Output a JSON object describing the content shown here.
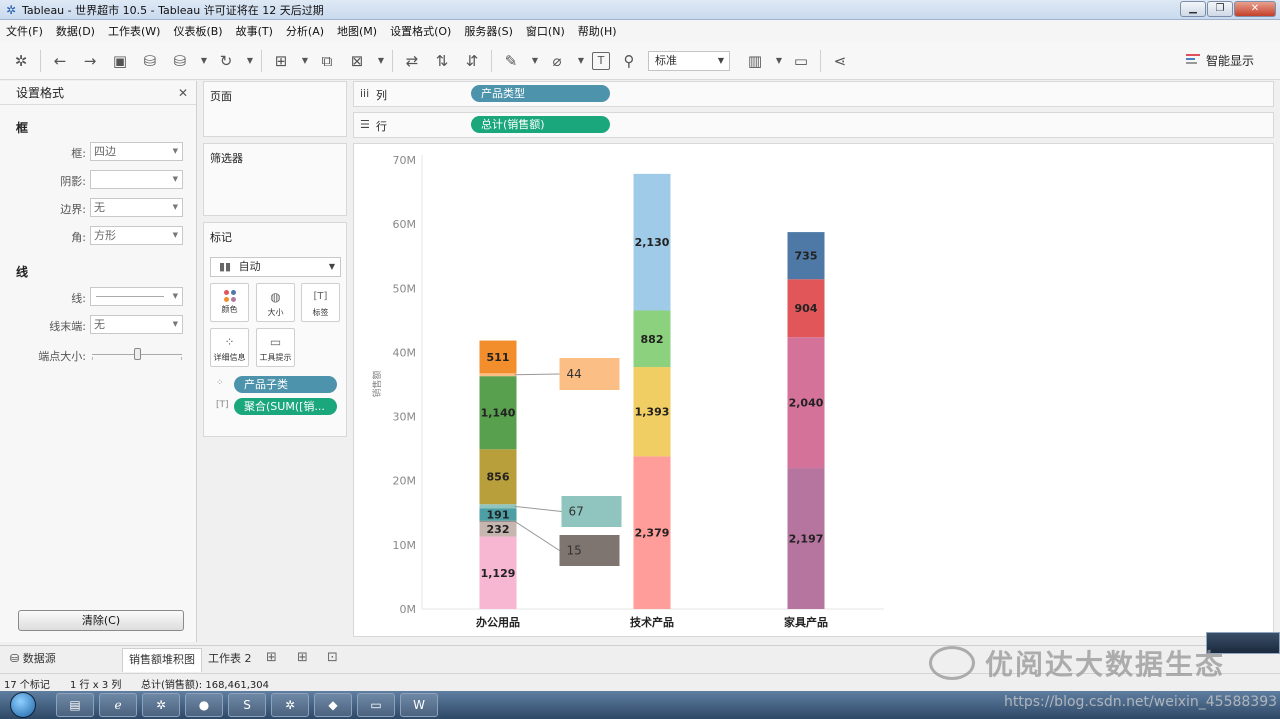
{
  "window": {
    "title": "Tableau - 世界超市 10.5 - Tableau 许可证将在 12 天后过期"
  },
  "menu": [
    "文件(F)",
    "数据(D)",
    "工作表(W)",
    "仪表板(B)",
    "故事(T)",
    "分析(A)",
    "地图(M)",
    "设置格式(O)",
    "服务器(S)",
    "窗口(N)",
    "帮助(H)"
  ],
  "toolbar": {
    "fit_value": "标准",
    "show_me": "智能显示"
  },
  "format_pane": {
    "title": "设置格式",
    "section_box": "框",
    "box_rows": [
      {
        "label": "框:",
        "value": "四边"
      },
      {
        "label": "阴影:",
        "value": ""
      },
      {
        "label": "边界:",
        "value": "无"
      },
      {
        "label": "角:",
        "value": "方形"
      }
    ],
    "section_line": "线",
    "line_rows": [
      {
        "label": "线:",
        "value": ""
      },
      {
        "label": "线末端:",
        "value": "无"
      }
    ],
    "endpoint_size_label": "端点大小:",
    "endpoint_size_level": 0.5,
    "clear_button": "清除(C)"
  },
  "shelves": {
    "pages": "页面",
    "filters": "筛选器",
    "marks": "标记",
    "marks_type": "自动",
    "mark_buttons": [
      "颜色",
      "大小",
      "标签",
      "详细信息",
      "工具提示"
    ],
    "mark_pills": [
      "产品子类",
      "聚合(SUM([销..."
    ],
    "columns_label": "列",
    "rows_label": "行",
    "columns_pill": "产品类型",
    "rows_pill": "总计(销售额)"
  },
  "chart_data": {
    "type": "bar",
    "stacked": true,
    "ylabel": "销售额",
    "ylim": [
      0,
      70000000
    ],
    "yticks": [
      "0M",
      "10M",
      "20M",
      "30M",
      "40M",
      "50M",
      "60M",
      "70M"
    ],
    "categories": [
      "办公用品",
      "技术产品",
      "家具产品"
    ],
    "bars": [
      {
        "category": "办公用品",
        "segments": [
          {
            "label": "1,129",
            "value": 11290000,
            "color": "#f7b6d2"
          },
          {
            "label": "232",
            "value": 2320000,
            "color": "#c7b6b0"
          },
          {
            "label": "15",
            "value": 150000,
            "color": "#7f7570",
            "callout": true
          },
          {
            "label": "191",
            "value": 1910000,
            "color": "#4d9fa6"
          },
          {
            "label": "67",
            "value": 670000,
            "color": "#8fc5be",
            "callout": true
          },
          {
            "label": "856",
            "value": 8560000,
            "color": "#b99f3c"
          },
          {
            "label": "1,140",
            "value": 11400000,
            "color": "#59a04e"
          },
          {
            "label": "44",
            "value": 440000,
            "color": "#fbbf85",
            "callout": true
          },
          {
            "label": "511",
            "value": 5110000,
            "color": "#f28e2b"
          }
        ]
      },
      {
        "category": "技术产品",
        "segments": [
          {
            "label": "2,379",
            "value": 23790000,
            "color": "#ff9d9a"
          },
          {
            "label": "1,393",
            "value": 13930000,
            "color": "#f1ce63"
          },
          {
            "label": "882",
            "value": 8820000,
            "color": "#8cd17d"
          },
          {
            "label": "2,130",
            "value": 21300000,
            "color": "#a0cbe8"
          }
        ]
      },
      {
        "category": "家具产品",
        "segments": [
          {
            "label": "2,197",
            "value": 21970000,
            "color": "#b6759f"
          },
          {
            "label": "2,040",
            "value": 20400000,
            "color": "#d4729a"
          },
          {
            "label": "904",
            "value": 9040000,
            "color": "#e15759"
          },
          {
            "label": "735",
            "value": 7350000,
            "color": "#4e79a7"
          }
        ]
      }
    ]
  },
  "tabs": {
    "datasource": "数据源",
    "active_sheet": "销售额堆积图",
    "other_sheet": "工作表 2"
  },
  "status": {
    "marks": "17 个标记",
    "dims": "1 行 x 3 列",
    "total": "总计(销售额): 168,461,304"
  },
  "watermark": {
    "brand": "优阅达大数据生态",
    "url": "https://blog.csdn.net/weixin_45588393"
  }
}
